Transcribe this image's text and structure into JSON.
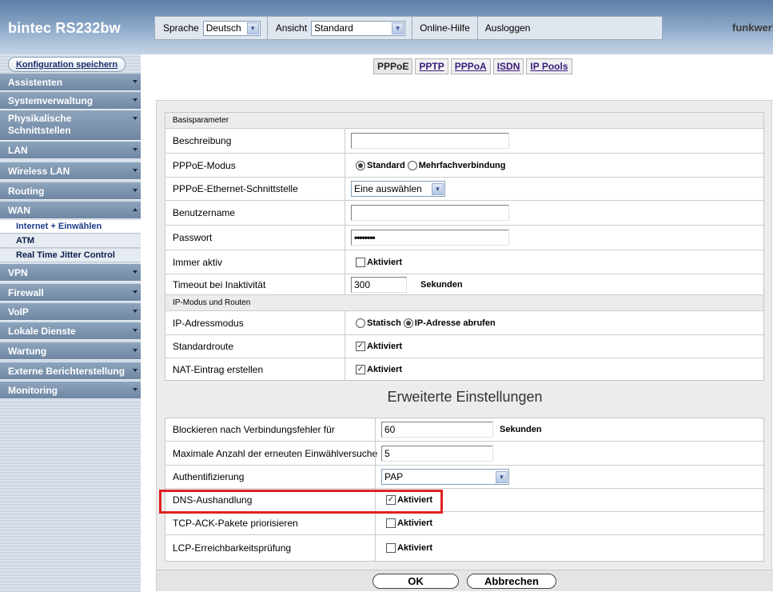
{
  "header": {
    "product": "bintec RS232bw",
    "language_label": "Sprache",
    "language_value": "Deutsch",
    "view_label": "Ansicht",
    "view_value": "Standard",
    "help_label": "Online-Hilfe",
    "logout_label": "Ausloggen",
    "logo_text": "funkwerk",
    "logo_waves": "))"
  },
  "sidebar": {
    "save_label": "Konfiguration speichern",
    "items": [
      {
        "label": "Assistenten"
      },
      {
        "label": "Systemverwaltung"
      },
      {
        "label": "Physikalische Schnittstellen"
      },
      {
        "label": "LAN"
      },
      {
        "label": "Wireless LAN"
      },
      {
        "label": "Routing"
      },
      {
        "label": "WAN"
      },
      {
        "label": "VPN"
      },
      {
        "label": "Firewall"
      },
      {
        "label": "VoIP"
      },
      {
        "label": "Lokale Dienste"
      },
      {
        "label": "Wartung"
      },
      {
        "label": "Externe Berichterstellung"
      },
      {
        "label": "Monitoring"
      }
    ],
    "wan_sub": [
      {
        "label": "Internet + Einwählen"
      },
      {
        "label": "ATM"
      },
      {
        "label": "Real Time Jitter Control"
      }
    ]
  },
  "tabs": [
    "PPPoE",
    "PPTP",
    "PPPoA",
    "ISDN",
    "IP Pools"
  ],
  "basic": {
    "section_title": "Basisparameter",
    "desc_label": "Beschreibung",
    "desc_value": "",
    "mode_label": "PPPoE-Modus",
    "mode_opt1": "Standard",
    "mode_opt2": "Mehrfachverbindung",
    "eth_label": "PPPoE-Ethernet-Schnittstelle",
    "eth_value": "Eine auswählen",
    "user_label": "Benutzername",
    "user_value": "",
    "pass_label": "Passwort",
    "pass_value": "••••••••",
    "always_label": "Immer aktiv",
    "always_value": "Aktiviert",
    "timeout_label": "Timeout bei Inaktivität",
    "timeout_value": "300",
    "timeout_unit": "Sekunden"
  },
  "ip": {
    "section_title": "IP-Modus und Routen",
    "mode_label": "IP-Adressmodus",
    "mode_opt1": "Statisch",
    "mode_opt2": "IP-Adresse abrufen",
    "route_label": "Standardroute",
    "route_value": "Aktiviert",
    "nat_label": "NAT-Eintrag erstellen",
    "nat_value": "Aktiviert"
  },
  "advanced": {
    "title": "Erweiterte Einstellungen",
    "block_label": "Blockieren nach Verbindungsfehler für",
    "block_value": "60",
    "block_unit": "Sekunden",
    "retry_label": "Maximale Anzahl der erneuten Einwählversuche",
    "retry_value": "5",
    "auth_label": "Authentifizierung",
    "auth_value": "PAP",
    "dns_label": "DNS-Aushandlung",
    "dns_value": "Aktiviert",
    "tcp_label": "TCP-ACK-Pakete priorisieren",
    "tcp_value": "Aktiviert",
    "lcp_label": "LCP-Erreichbarkeitsprüfung",
    "lcp_value": "Aktiviert"
  },
  "buttons": {
    "ok": "OK",
    "cancel": "Abbrechen"
  },
  "colors": {
    "highlight": "#e02020",
    "nav_bg": "#7a90ab"
  }
}
